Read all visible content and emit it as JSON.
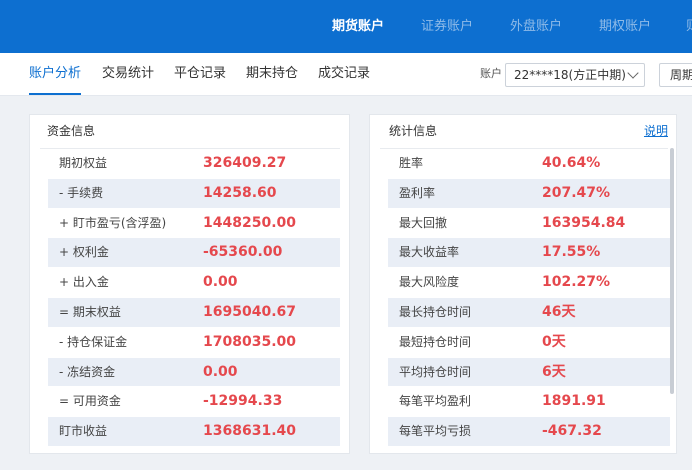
{
  "top_tabs": [
    {
      "label": "期货账户",
      "active": true
    },
    {
      "label": "证券账户",
      "active": false
    },
    {
      "label": "外盘账户",
      "active": false
    },
    {
      "label": "期权账户",
      "active": false
    },
    {
      "label": "则",
      "active": false
    }
  ],
  "sub_tabs": [
    {
      "label": "账户分析",
      "active": true
    },
    {
      "label": "交易统计",
      "active": false
    },
    {
      "label": "平仓记录",
      "active": false
    },
    {
      "label": "期末持仓",
      "active": false
    },
    {
      "label": "成交记录",
      "active": false
    }
  ],
  "account": {
    "label": "账户",
    "selected": "22****18(方正中期)",
    "period_label": "周期"
  },
  "funds": {
    "title": "资金信息",
    "rows": [
      {
        "label": "期初权益",
        "value": "326409.27"
      },
      {
        "label": "- 手续费",
        "value": "14258.60"
      },
      {
        "label": "+ 盯市盈亏(含浮盈)",
        "value": "1448250.00"
      },
      {
        "label": "+ 权利金",
        "value": "-65360.00"
      },
      {
        "label": "+ 出入金",
        "value": "0.00"
      },
      {
        "label": "= 期末权益",
        "value": "1695040.67"
      },
      {
        "label": "- 持仓保证金",
        "value": "1708035.00"
      },
      {
        "label": "- 冻结资金",
        "value": "0.00"
      },
      {
        "label": "= 可用资金",
        "value": "-12994.33"
      },
      {
        "label": "盯市收益",
        "value": "1368631.40"
      }
    ]
  },
  "stats": {
    "title": "统计信息",
    "help_label": "说明",
    "rows": [
      {
        "label": "胜率",
        "value": "40.64%"
      },
      {
        "label": "盈利率",
        "value": "207.47%"
      },
      {
        "label": "最大回撤",
        "value": "163954.84"
      },
      {
        "label": "最大收益率",
        "value": "17.55%"
      },
      {
        "label": "最大风险度",
        "value": "102.27%"
      },
      {
        "label": "最长持仓时间",
        "value": "46天"
      },
      {
        "label": "最短持仓时间",
        "value": "0天"
      },
      {
        "label": "平均持仓时间",
        "value": "6天"
      },
      {
        "label": "每笔平均盈利",
        "value": "1891.91"
      },
      {
        "label": "每笔平均亏损",
        "value": "-467.32"
      }
    ]
  },
  "colors": {
    "brand_blue": "#0d6fd0",
    "value_red": "#e5484d",
    "row_shade": "#e9eef6"
  }
}
